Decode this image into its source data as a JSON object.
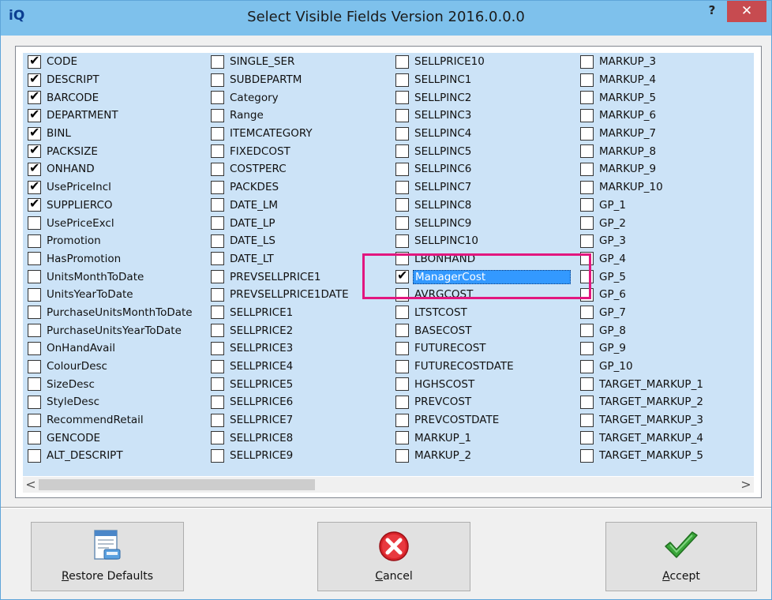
{
  "window": {
    "app_icon": "iQ",
    "title": "Select Visible Fields Version 2016.0.0.0",
    "help_label": "?",
    "close_label": "✕"
  },
  "columns": [
    [
      {
        "label": "CODE",
        "checked": true
      },
      {
        "label": "DESCRIPT",
        "checked": true
      },
      {
        "label": "BARCODE",
        "checked": true
      },
      {
        "label": "DEPARTMENT",
        "checked": true
      },
      {
        "label": "BINL",
        "checked": true
      },
      {
        "label": "PACKSIZE",
        "checked": true
      },
      {
        "label": "ONHAND",
        "checked": true
      },
      {
        "label": "UsePriceIncl",
        "checked": true
      },
      {
        "label": "SUPPLIERCO",
        "checked": true
      },
      {
        "label": "UsePriceExcl",
        "checked": false
      },
      {
        "label": "Promotion",
        "checked": false
      },
      {
        "label": "HasPromotion",
        "checked": false
      },
      {
        "label": "UnitsMonthToDate",
        "checked": false
      },
      {
        "label": "UnitsYearToDate",
        "checked": false
      },
      {
        "label": "PurchaseUnitsMonthToDate",
        "checked": false
      },
      {
        "label": "PurchaseUnitsYearToDate",
        "checked": false
      },
      {
        "label": "OnHandAvail",
        "checked": false
      },
      {
        "label": "ColourDesc",
        "checked": false
      },
      {
        "label": "SizeDesc",
        "checked": false
      },
      {
        "label": "StyleDesc",
        "checked": false
      },
      {
        "label": "RecommendRetail",
        "checked": false
      },
      {
        "label": "GENCODE",
        "checked": false
      },
      {
        "label": "ALT_DESCRIPT",
        "checked": false
      }
    ],
    [
      {
        "label": "SINGLE_SER",
        "checked": false
      },
      {
        "label": "SUBDEPARTM",
        "checked": false
      },
      {
        "label": "Category",
        "checked": false
      },
      {
        "label": "Range",
        "checked": false
      },
      {
        "label": "ITEMCATEGORY",
        "checked": false
      },
      {
        "label": "FIXEDCOST",
        "checked": false
      },
      {
        "label": "COSTPERC",
        "checked": false
      },
      {
        "label": "PACKDES",
        "checked": false
      },
      {
        "label": "DATE_LM",
        "checked": false
      },
      {
        "label": "DATE_LP",
        "checked": false
      },
      {
        "label": "DATE_LS",
        "checked": false
      },
      {
        "label": "DATE_LT",
        "checked": false
      },
      {
        "label": "PREVSELLPRICE1",
        "checked": false
      },
      {
        "label": "PREVSELLPRICE1DATE",
        "checked": false
      },
      {
        "label": "SELLPRICE1",
        "checked": false
      },
      {
        "label": "SELLPRICE2",
        "checked": false
      },
      {
        "label": "SELLPRICE3",
        "checked": false
      },
      {
        "label": "SELLPRICE4",
        "checked": false
      },
      {
        "label": "SELLPRICE5",
        "checked": false
      },
      {
        "label": "SELLPRICE6",
        "checked": false
      },
      {
        "label": "SELLPRICE7",
        "checked": false
      },
      {
        "label": "SELLPRICE8",
        "checked": false
      },
      {
        "label": "SELLPRICE9",
        "checked": false
      }
    ],
    [
      {
        "label": "SELLPRICE10",
        "checked": false
      },
      {
        "label": "SELLPINC1",
        "checked": false
      },
      {
        "label": "SELLPINC2",
        "checked": false
      },
      {
        "label": "SELLPINC3",
        "checked": false
      },
      {
        "label": "SELLPINC4",
        "checked": false
      },
      {
        "label": "SELLPINC5",
        "checked": false
      },
      {
        "label": "SELLPINC6",
        "checked": false
      },
      {
        "label": "SELLPINC7",
        "checked": false
      },
      {
        "label": "SELLPINC8",
        "checked": false
      },
      {
        "label": "SELLPINC9",
        "checked": false
      },
      {
        "label": "SELLPINC10",
        "checked": false
      },
      {
        "label": "LBONHAND",
        "checked": false
      },
      {
        "label": "ManagerCost",
        "checked": true,
        "selected": true
      },
      {
        "label": "AVRGCOST",
        "checked": false
      },
      {
        "label": "LTSTCOST",
        "checked": false
      },
      {
        "label": "BASECOST",
        "checked": false
      },
      {
        "label": "FUTURECOST",
        "checked": false
      },
      {
        "label": "FUTURECOSTDATE",
        "checked": false
      },
      {
        "label": "HGHSCOST",
        "checked": false
      },
      {
        "label": "PREVCOST",
        "checked": false
      },
      {
        "label": "PREVCOSTDATE",
        "checked": false
      },
      {
        "label": "MARKUP_1",
        "checked": false
      },
      {
        "label": "MARKUP_2",
        "checked": false
      }
    ],
    [
      {
        "label": "MARKUP_3",
        "checked": false
      },
      {
        "label": "MARKUP_4",
        "checked": false
      },
      {
        "label": "MARKUP_5",
        "checked": false
      },
      {
        "label": "MARKUP_6",
        "checked": false
      },
      {
        "label": "MARKUP_7",
        "checked": false
      },
      {
        "label": "MARKUP_8",
        "checked": false
      },
      {
        "label": "MARKUP_9",
        "checked": false
      },
      {
        "label": "MARKUP_10",
        "checked": false
      },
      {
        "label": "GP_1",
        "checked": false
      },
      {
        "label": "GP_2",
        "checked": false
      },
      {
        "label": "GP_3",
        "checked": false
      },
      {
        "label": "GP_4",
        "checked": false
      },
      {
        "label": "GP_5",
        "checked": false
      },
      {
        "label": "GP_6",
        "checked": false
      },
      {
        "label": "GP_7",
        "checked": false
      },
      {
        "label": "GP_8",
        "checked": false
      },
      {
        "label": "GP_9",
        "checked": false
      },
      {
        "label": "GP_10",
        "checked": false
      },
      {
        "label": "TARGET_MARKUP_1",
        "checked": false
      },
      {
        "label": "TARGET_MARKUP_2",
        "checked": false
      },
      {
        "label": "TARGET_MARKUP_3",
        "checked": false
      },
      {
        "label": "TARGET_MARKUP_4",
        "checked": false
      },
      {
        "label": "TARGET_MARKUP_5",
        "checked": false
      }
    ]
  ],
  "scrollbar": {
    "left_arrow": "<",
    "right_arrow": ">"
  },
  "buttons": {
    "restore": {
      "accel": "R",
      "rest": "estore Defaults",
      "icon": "restore-defaults-icon"
    },
    "cancel": {
      "accel": "C",
      "rest": "ancel",
      "icon": "cancel-icon"
    },
    "accept": {
      "accel": "A",
      "rest": "ccept",
      "icon": "checkmark-icon"
    }
  },
  "colors": {
    "titlebar": "#7ec1ec",
    "list_background": "#cce3f7",
    "selection": "#3399ff",
    "highlight_box": "#e2167f",
    "close_button": "#c74b50"
  }
}
